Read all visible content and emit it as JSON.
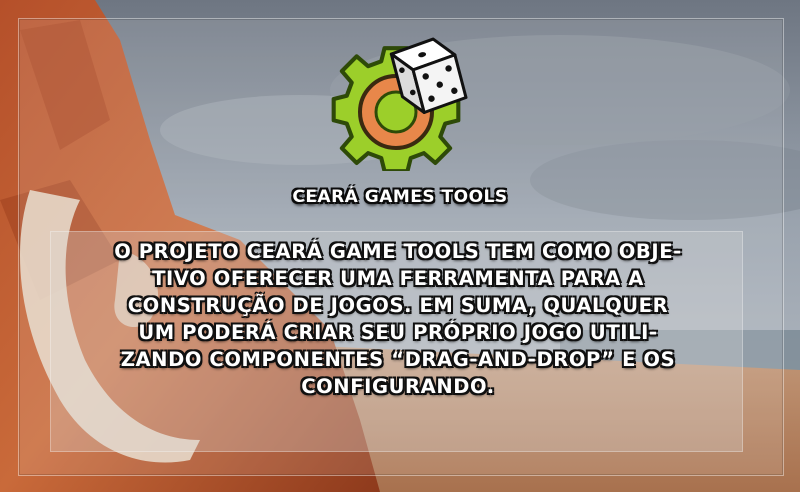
{
  "brand": {
    "name": "CEARÁ GAMES TOOLS"
  },
  "description": {
    "lines": [
      "O PROJETO CEARÁ GAME TOOLS TEM COMO OBJE-",
      "TIVO OFERECER UMA FERRAMENTA PARA A",
      "CONSTRUÇÃO DE JOGOS. EM SUMA, QUALQUER",
      "UM PODERÁ CRIAR SEU PRÓPRIO JOGO UTILI-",
      "ZANDO COMPONENTES “DRAG-AND-DROP” E OS",
      "CONFIGURANDO."
    ]
  },
  "colors": {
    "gear_outer": "#9ccf2a",
    "gear_inner": "#e8874a",
    "dice": "#f4f4f4",
    "text": "#ffffff",
    "outline": "#101010"
  },
  "icons": {
    "logo": "gear-with-dice-icon"
  }
}
